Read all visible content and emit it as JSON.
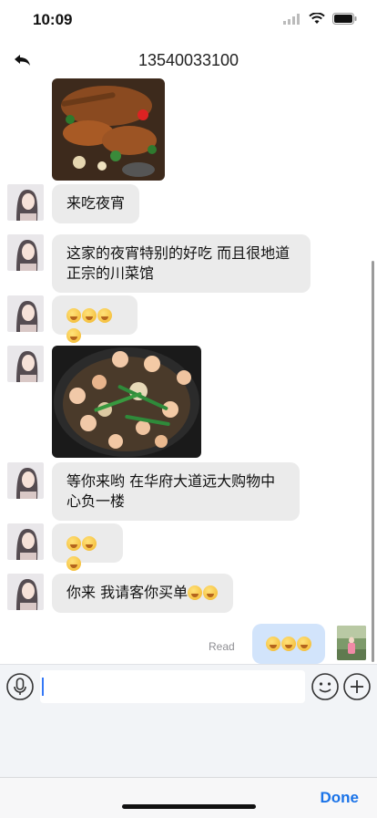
{
  "status_bar": {
    "time": "10:09"
  },
  "nav": {
    "title": "13540033100"
  },
  "messages": {
    "m1": "来吃夜宵",
    "m2": "这家的夜宵特别的好吃 而且很地道正宗的川菜馆",
    "m5": "等你来哟 在华府大道远大购物中心负一楼",
    "m7": "你来 我请客你买单"
  },
  "my_message": {
    "read_label": "Read"
  },
  "input": {
    "value": "",
    "placeholder": ""
  },
  "accessory": {
    "done_label": "Done"
  },
  "colors": {
    "incoming_bubble": "#ebebeb",
    "outgoing_bubble": "#d2e4fb",
    "accent": "#1a73e8"
  }
}
